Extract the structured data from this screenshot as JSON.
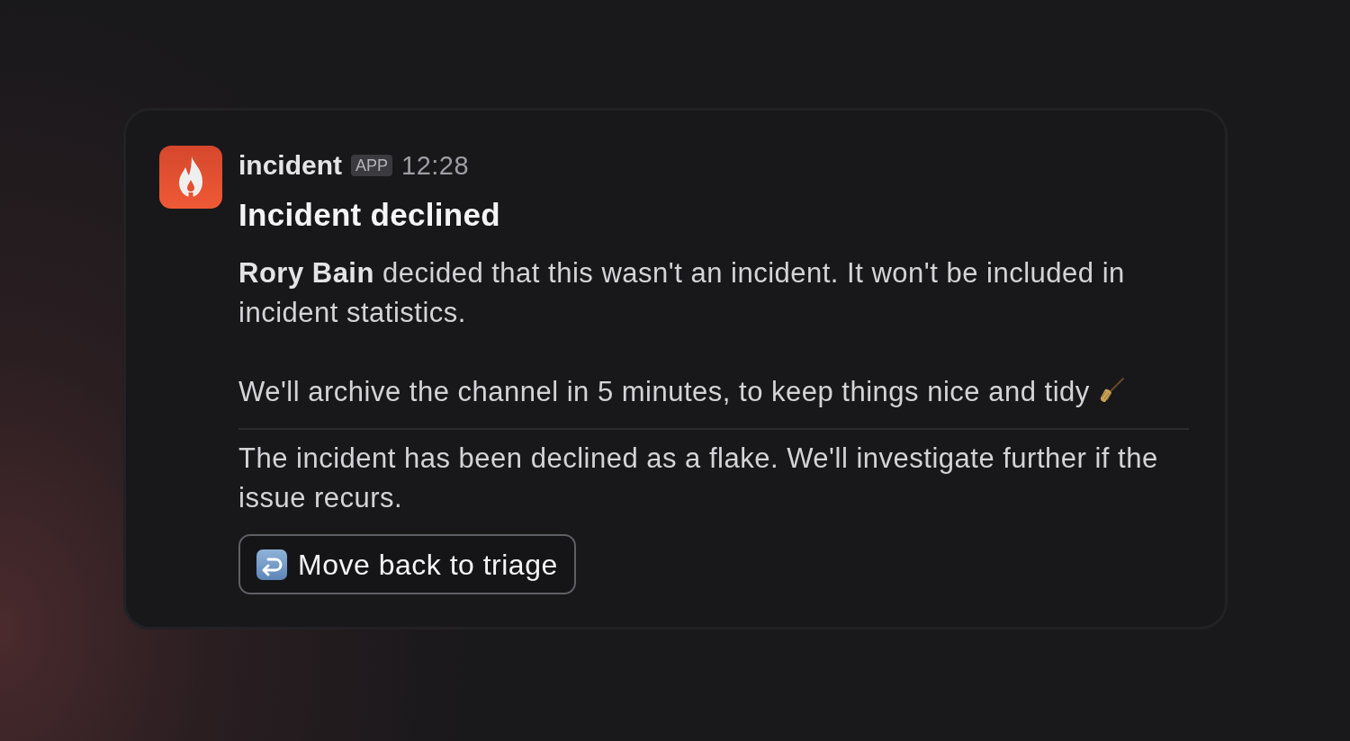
{
  "message": {
    "sender": "incident",
    "badge": "APP",
    "time": "12:28",
    "title": "Incident declined",
    "body": [
      "**Rory Bain** decided that this wasn't an incident. It won't be included in incident statistics.",
      "We'll archive the channel in 5 minutes, to keep things nice and tidy"
    ],
    "note": "The incident has been declined as a flake. We'll investigate further if the issue recurs.",
    "actions": [
      {
        "label": "Move back to triage"
      }
    ]
  }
}
